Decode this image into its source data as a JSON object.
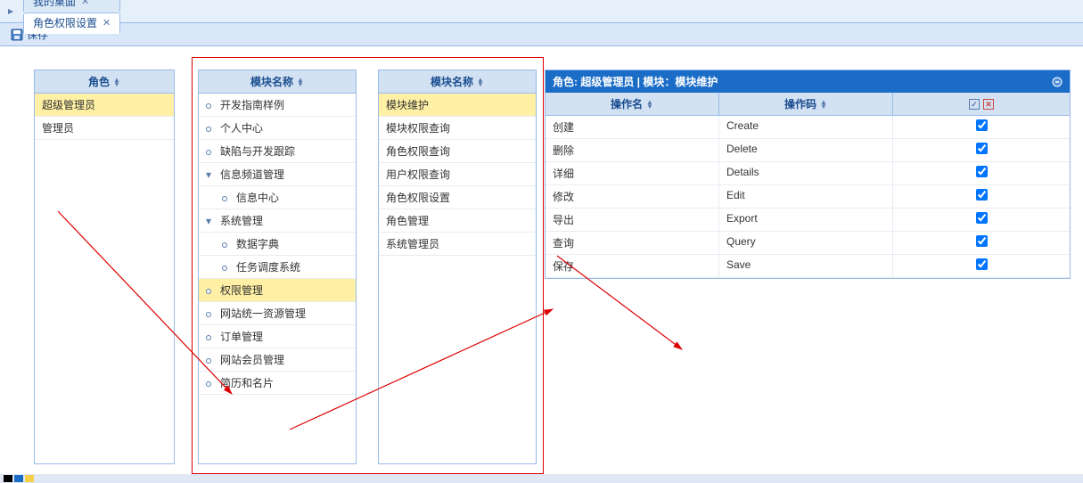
{
  "tabs": {
    "items": [
      {
        "label": "我的桌面",
        "closable": true,
        "active": false
      },
      {
        "label": "角色权限设置",
        "closable": true,
        "active": true
      }
    ]
  },
  "toolbar": {
    "save_label": "保存"
  },
  "role_panel": {
    "header": "角色",
    "items": [
      {
        "label": "超级管理员",
        "selected": true
      },
      {
        "label": "管理员",
        "selected": false
      }
    ]
  },
  "module_panel_1": {
    "header": "模块名称",
    "items": [
      {
        "label": "开发指南样例",
        "type": "leaf",
        "indent": 0
      },
      {
        "label": "个人中心",
        "type": "leaf",
        "indent": 0
      },
      {
        "label": "缺陷与开发跟踪",
        "type": "leaf",
        "indent": 0
      },
      {
        "label": "信息频道管理",
        "type": "expanded",
        "indent": 0
      },
      {
        "label": "信息中心",
        "type": "leaf",
        "indent": 1
      },
      {
        "label": "系统管理",
        "type": "expanded",
        "indent": 0
      },
      {
        "label": "数据字典",
        "type": "leaf",
        "indent": 1
      },
      {
        "label": "任务调度系统",
        "type": "leaf",
        "indent": 1
      },
      {
        "label": "权限管理",
        "type": "leaf",
        "indent": 0,
        "selected": true
      },
      {
        "label": "网站统一资源管理",
        "type": "leaf",
        "indent": 0
      },
      {
        "label": "订单管理",
        "type": "leaf",
        "indent": 0
      },
      {
        "label": "网站会员管理",
        "type": "leaf",
        "indent": 0
      },
      {
        "label": "简历和名片",
        "type": "leaf",
        "indent": 0
      }
    ]
  },
  "module_panel_2": {
    "header": "模块名称",
    "items": [
      {
        "label": "模块维护",
        "selected": true
      },
      {
        "label": "模块权限查询"
      },
      {
        "label": "角色权限查询"
      },
      {
        "label": "用户权限查询"
      },
      {
        "label": "角色权限设置"
      },
      {
        "label": "角色管理"
      },
      {
        "label": "系统管理员"
      }
    ]
  },
  "op_panel": {
    "title": "角色: 超级管理员  | 模块：模块维护",
    "cols": {
      "name": "操作名",
      "code": "操作码"
    },
    "rows": [
      {
        "name": "创建",
        "code": "Create",
        "checked": true
      },
      {
        "name": "删除",
        "code": "Delete",
        "checked": true
      },
      {
        "name": "详细",
        "code": "Details",
        "checked": true
      },
      {
        "name": "修改",
        "code": "Edit",
        "checked": true
      },
      {
        "name": "导出",
        "code": "Export",
        "checked": true
      },
      {
        "name": "查询",
        "code": "Query",
        "checked": true
      },
      {
        "name": "保存",
        "code": "Save",
        "checked": true
      }
    ]
  },
  "colors": {
    "accent": "#1a6cc7",
    "highlight": "#fff0a5",
    "border": "#99bbe8"
  }
}
